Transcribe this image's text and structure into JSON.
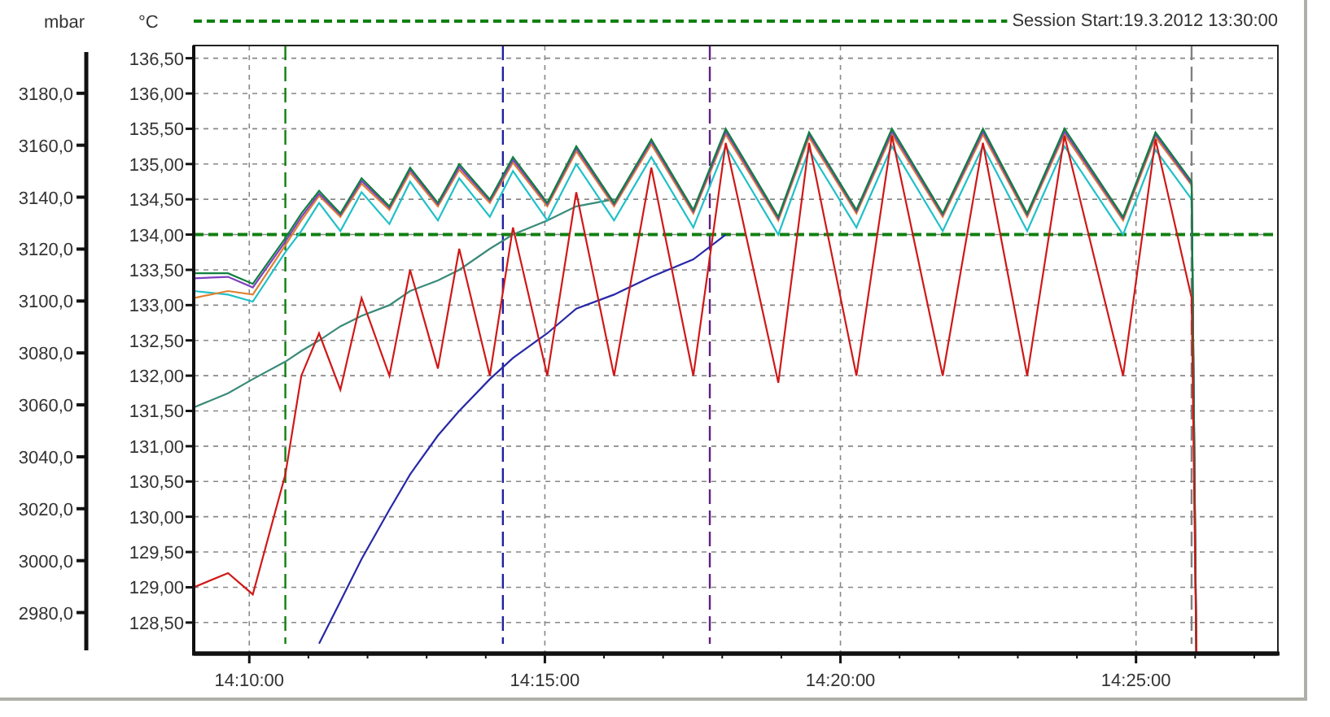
{
  "chart": {
    "chart_data": {
      "type": "line",
      "grid": true,
      "title": "Session Start:19.3.2012 13:30:00",
      "ylabel": "°C",
      "y2label": "mbar",
      "xlim": [
        50943.6,
        52044
      ],
      "ylim": [
        128.06,
        136.68
      ],
      "y2lim": [
        2964.2,
        3198.4
      ],
      "xticks": [
        {
          "value": 51000,
          "label": "14:10:00"
        },
        {
          "value": 51300,
          "label": "14:15:00"
        },
        {
          "value": 51600,
          "label": "14:20:00"
        },
        {
          "value": 51900,
          "label": "14:25:00"
        }
      ],
      "yticks": [
        {
          "value": 128.5,
          "label": "128,50"
        },
        {
          "value": 129,
          "label": "129,00"
        },
        {
          "value": 129.5,
          "label": "129,50"
        },
        {
          "value": 130,
          "label": "130,00"
        },
        {
          "value": 130.5,
          "label": "130,50"
        },
        {
          "value": 131,
          "label": "131,00"
        },
        {
          "value": 131.5,
          "label": "131,50"
        },
        {
          "value": 132,
          "label": "132,00"
        },
        {
          "value": 132.5,
          "label": "132,50"
        },
        {
          "value": 133,
          "label": "133,00"
        },
        {
          "value": 133.5,
          "label": "133,50"
        },
        {
          "value": 134,
          "label": "134,00"
        },
        {
          "value": 134.5,
          "label": "134,50"
        },
        {
          "value": 135,
          "label": "135,00"
        },
        {
          "value": 135.5,
          "label": "135,50"
        },
        {
          "value": 136,
          "label": "136,00"
        },
        {
          "value": 136.5,
          "label": "136,50"
        }
      ],
      "y2ticks": [
        {
          "value": 2980,
          "label": "2980,0"
        },
        {
          "value": 3000,
          "label": "3000,0"
        },
        {
          "value": 3020,
          "label": "3020,0"
        },
        {
          "value": 3040,
          "label": "3040,0"
        },
        {
          "value": 3060,
          "label": "3060,0"
        },
        {
          "value": 3080,
          "label": "3080,0"
        },
        {
          "value": 3100,
          "label": "3100,0"
        },
        {
          "value": 3120,
          "label": "3120,0"
        },
        {
          "value": 3140,
          "label": "3140,0"
        },
        {
          "value": 3160,
          "label": "3160,0"
        },
        {
          "value": 3180,
          "label": "3180,0"
        }
      ],
      "x": [
        50943.6,
        50978.4,
        51003.6,
        51036.6,
        51052.8,
        51070.8,
        51092.4,
        51114,
        51142.2,
        51163.2,
        51191.4,
        51213,
        51244.2,
        51267.6,
        51302.4,
        51331.8,
        51370.2,
        51408,
        51450.6,
        51483.6,
        51537,
        51568.2,
        51616.2,
        51652.2,
        51703.8,
        51744.6,
        51789.6,
        51827.4,
        51886.8,
        51919.8,
        51956.4,
        51961.2
      ],
      "series": [
        {
          "color": "#3a8a78",
          "values": [
            131.55,
            131.75,
            131.95,
            132.2,
            132.35,
            132.5,
            132.7,
            132.85,
            133.0,
            133.2,
            133.35,
            133.5,
            133.8,
            134.0,
            134.2,
            134.4,
            134.5,
            null,
            null,
            null,
            null,
            null,
            null,
            null,
            null,
            null,
            null,
            null,
            null,
            null,
            null,
            null
          ]
        },
        {
          "color": "#2828a8",
          "values": [
            null,
            null,
            null,
            null,
            null,
            128.2,
            128.8,
            129.4,
            130.1,
            130.6,
            131.15,
            131.5,
            131.95,
            132.25,
            132.6,
            132.95,
            133.15,
            133.4,
            133.65,
            134.0,
            null,
            null,
            null,
            null,
            null,
            null,
            null,
            null,
            null,
            null,
            null,
            null
          ]
        },
        {
          "color": "#20c0c8",
          "values": [
            133.2,
            133.15,
            133.05,
            133.75,
            134.05,
            134.45,
            134.05,
            134.6,
            134.15,
            134.75,
            134.2,
            134.8,
            134.25,
            134.9,
            134.2,
            135.0,
            134.2,
            135.1,
            134.1,
            135.25,
            134.0,
            135.2,
            134.1,
            135.25,
            134.05,
            135.25,
            134.05,
            135.25,
            134.0,
            135.2,
            134.5,
            128.06
          ]
        },
        {
          "color": "#e08030",
          "values": [
            133.1,
            133.2,
            133.15,
            133.85,
            134.2,
            134.55,
            134.25,
            134.72,
            134.35,
            134.88,
            134.4,
            134.92,
            134.45,
            135.02,
            134.4,
            135.18,
            134.4,
            135.28,
            134.3,
            135.42,
            134.2,
            135.38,
            134.3,
            135.42,
            134.25,
            135.42,
            134.25,
            135.42,
            134.2,
            135.38,
            134.7,
            128.06
          ]
        },
        {
          "color": "#8040c0",
          "values": [
            133.38,
            133.4,
            133.25,
            133.9,
            134.25,
            134.58,
            134.28,
            134.76,
            134.38,
            134.92,
            134.43,
            134.96,
            134.48,
            135.06,
            134.43,
            135.22,
            134.43,
            135.32,
            134.33,
            135.46,
            134.23,
            135.42,
            134.33,
            135.46,
            134.28,
            135.46,
            134.28,
            135.46,
            134.23,
            135.42,
            134.72,
            128.06
          ]
        },
        {
          "color": "#108040",
          "values": [
            133.45,
            133.45,
            133.3,
            133.95,
            134.3,
            134.62,
            134.3,
            134.8,
            134.4,
            134.95,
            134.45,
            135.0,
            134.5,
            135.1,
            134.45,
            135.25,
            134.45,
            135.35,
            134.35,
            135.5,
            134.25,
            135.45,
            134.35,
            135.5,
            134.3,
            135.5,
            134.3,
            135.5,
            134.25,
            135.45,
            134.75,
            128.06
          ]
        },
        {
          "color": "#d01818",
          "values": [
            129.0,
            129.2,
            128.9,
            130.6,
            132.0,
            132.6,
            131.8,
            133.1,
            132.0,
            133.5,
            132.1,
            133.8,
            132.0,
            134.1,
            132.0,
            134.6,
            132.0,
            134.95,
            132.0,
            135.3,
            131.9,
            135.3,
            132.0,
            135.4,
            132.0,
            135.3,
            132.0,
            135.4,
            132.0,
            135.35,
            133.1,
            128.06
          ]
        }
      ],
      "ref_lines": [
        {
          "axis": "x",
          "value": 51036.6,
          "color": "#108010"
        },
        {
          "axis": "x",
          "value": 51257.4,
          "color": "#2020a0"
        },
        {
          "axis": "x",
          "value": 51467.4,
          "color": "#602080"
        },
        {
          "axis": "x",
          "value": 51956.4,
          "color": "#808080"
        },
        {
          "axis": "y",
          "value": 134,
          "color": "#108010"
        }
      ]
    }
  }
}
